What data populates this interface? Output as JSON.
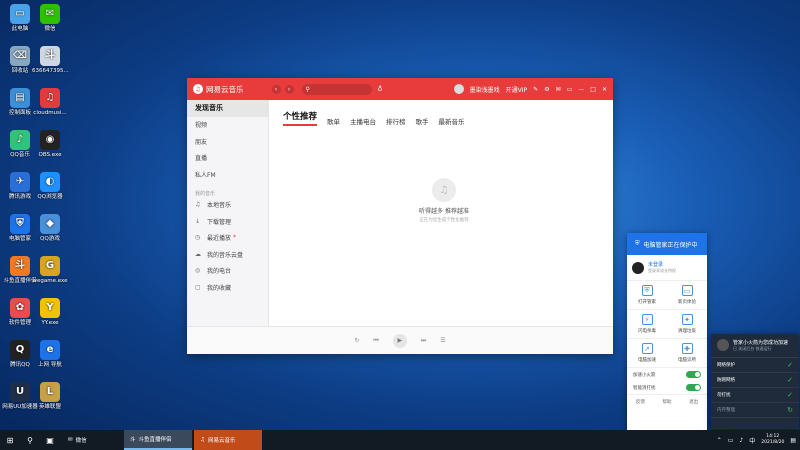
{
  "desktop": {
    "icons": [
      {
        "label": "此电脑",
        "col": 0,
        "row": 0,
        "color": "#4aa3e8",
        "glyph": "▭"
      },
      {
        "label": "微信",
        "col": 1,
        "row": 0,
        "color": "#2dc100",
        "glyph": "✉"
      },
      {
        "label": "回收站",
        "col": 0,
        "row": 1,
        "color": "#8aa7c0",
        "glyph": "⌫"
      },
      {
        "label": "636647395...",
        "col": 1,
        "row": 1,
        "color": "#cfd8e2",
        "glyph": "斗"
      },
      {
        "label": "控制面板",
        "col": 0,
        "row": 2,
        "color": "#3c8fd6",
        "glyph": "▤"
      },
      {
        "label": "cloudmusi...",
        "col": 1,
        "row": 2,
        "color": "#e23b3b",
        "glyph": "♫"
      },
      {
        "label": "QQ音乐",
        "col": 0,
        "row": 3,
        "color": "#31c27c",
        "glyph": "♪"
      },
      {
        "label": "OBS.exe",
        "col": 1,
        "row": 3,
        "color": "#222222",
        "glyph": "◉"
      },
      {
        "label": "腾讯游戏",
        "col": 0,
        "row": 4,
        "color": "#2a6fd8",
        "glyph": "✈"
      },
      {
        "label": "QQ浏览器",
        "col": 1,
        "row": 4,
        "color": "#1e90ff",
        "glyph": "◐"
      },
      {
        "label": "电脑管家",
        "col": 0,
        "row": 5,
        "color": "#1e73e8",
        "glyph": "⛨"
      },
      {
        "label": "QQ游戏",
        "col": 1,
        "row": 5,
        "color": "#4a8fd8",
        "glyph": "◆"
      },
      {
        "label": "斗鱼直播伴侣",
        "col": 0,
        "row": 6,
        "color": "#f07a21",
        "glyph": "斗"
      },
      {
        "label": "wegame.exe",
        "col": 1,
        "row": 6,
        "color": "#d9a520",
        "glyph": "G"
      },
      {
        "label": "软件管理",
        "col": 0,
        "row": 7,
        "color": "#e94d4d",
        "glyph": "✿"
      },
      {
        "label": "YY.exe",
        "col": 1,
        "row": 7,
        "color": "#f2c200",
        "glyph": "Y"
      },
      {
        "label": "腾讯QQ",
        "col": 0,
        "row": 8,
        "color": "#222222",
        "glyph": "Q"
      },
      {
        "label": "上网 导航",
        "col": 1,
        "row": 8,
        "color": "#1e73e8",
        "glyph": "e"
      },
      {
        "label": "网易UU加速器",
        "col": 0,
        "row": 9,
        "color": "#1f2f4a",
        "glyph": "U"
      },
      {
        "label": "英雄联盟",
        "col": 1,
        "row": 9,
        "color": "#c8a045",
        "glyph": "L"
      }
    ]
  },
  "music": {
    "app_name": "网易云音乐",
    "search_icon": "search-icon",
    "user": "墨染浅墨戏",
    "vip": "开通VIP",
    "sidebar": [
      {
        "label": "发现音乐",
        "active": true
      },
      {
        "label": "视频"
      },
      {
        "label": "朋友"
      },
      {
        "label": "直播"
      },
      {
        "label": "私人FM"
      }
    ],
    "my_music_head": "我的音乐",
    "my_music": [
      {
        "label": "本地音乐",
        "icon": "♫"
      },
      {
        "label": "下载管理",
        "icon": "↓"
      },
      {
        "label": "最近播放",
        "icon": "◷",
        "dot": "*"
      },
      {
        "label": "我的音乐云盘",
        "icon": "☁"
      },
      {
        "label": "我的电台",
        "icon": "◎"
      },
      {
        "label": "我的收藏",
        "icon": "▢"
      }
    ],
    "tabs": [
      "个性推荐",
      "歌单",
      "主播电台",
      "排行榜",
      "歌手",
      "最新音乐"
    ],
    "empty_title": "听得越多 推荐越准",
    "empty_sub": "正在为您生成个性化推荐"
  },
  "guard": {
    "header": "电脑管家正在保护中",
    "user_name": "未登录",
    "user_sub": "登录享成长特权",
    "tools": [
      {
        "label": "打开管家",
        "glyph": "⛨"
      },
      {
        "label": "新页体验",
        "glyph": "▭"
      },
      {
        "label": "闪电杀毒",
        "glyph": "⚡"
      },
      {
        "label": "清理垃圾",
        "glyph": "✦"
      },
      {
        "label": "电脑加速",
        "glyph": "➚"
      },
      {
        "label": "电脑诊所",
        "glyph": "✚"
      }
    ],
    "toggles": [
      {
        "label": "加速小火箭",
        "on": true
      },
      {
        "label": "智能消打扰",
        "on": true
      }
    ],
    "footer": [
      "反馈",
      "帮助",
      "退出"
    ]
  },
  "fire": {
    "title": "管家小火箭为您成功加速",
    "subtitle": "已 关闭后台 快速运行",
    "rows": [
      {
        "label": "网络保护",
        "checked": true
      },
      {
        "label": "防蹭网络",
        "checked": true
      },
      {
        "label": "勿打扰",
        "checked": true
      },
      {
        "label": "内存整理",
        "checked": false
      }
    ]
  },
  "taskbar": {
    "apps": [
      {
        "label": "微信",
        "icon": "✉",
        "state": "plain"
      },
      {
        "label": "斗鱼直播伴侣",
        "icon": "斗",
        "state": "on"
      },
      {
        "label": "网易云音乐",
        "icon": "♫",
        "state": "active"
      }
    ],
    "time": "14:12",
    "date": "2021/8/20"
  },
  "colors": {
    "music_red": "#e83c3c",
    "guard_blue": "#1e73e8",
    "toggle_green": "#2fa84f"
  }
}
